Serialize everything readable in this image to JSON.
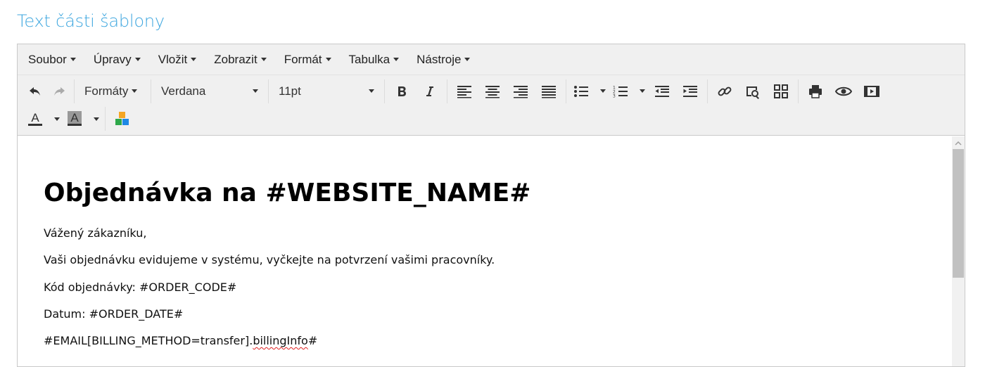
{
  "section_title": "Text části šablony",
  "menubar": {
    "items": [
      "Soubor",
      "Úpravy",
      "Vložit",
      "Zobrazit",
      "Formát",
      "Tabulka",
      "Nástroje"
    ]
  },
  "toolbar": {
    "formats_label": "Formáty",
    "font_family": "Verdana",
    "font_size": "11pt",
    "text_color_glyph": "A",
    "background_color_glyph": "A",
    "text_color_underline": "#333333",
    "background_color_fill": "#999999",
    "plugin_colors": [
      "#f5a623",
      "#2ea84a",
      "#1e88e5"
    ]
  },
  "content": {
    "heading": "Objednávka na #WEBSITE_NAME#",
    "paragraphs": {
      "greeting": "Vážený zákazníku,",
      "info": "Vaši objednávku evidujeme v systému, vyčkejte na potvrzení vašimi pracovníky.",
      "order_code": "Kód objednávky: #ORDER_CODE#",
      "order_date": "Datum: #ORDER_DATE#",
      "email_prefix": "#EMAIL[BILLING_METHOD=transfer].",
      "email_misspelled": "billingInfo",
      "email_suffix": "#"
    }
  },
  "colors": {
    "title_accent": "#3fa7df",
    "toolbar_bg": "#f0f0f0",
    "spellcheck": "#e02020"
  }
}
